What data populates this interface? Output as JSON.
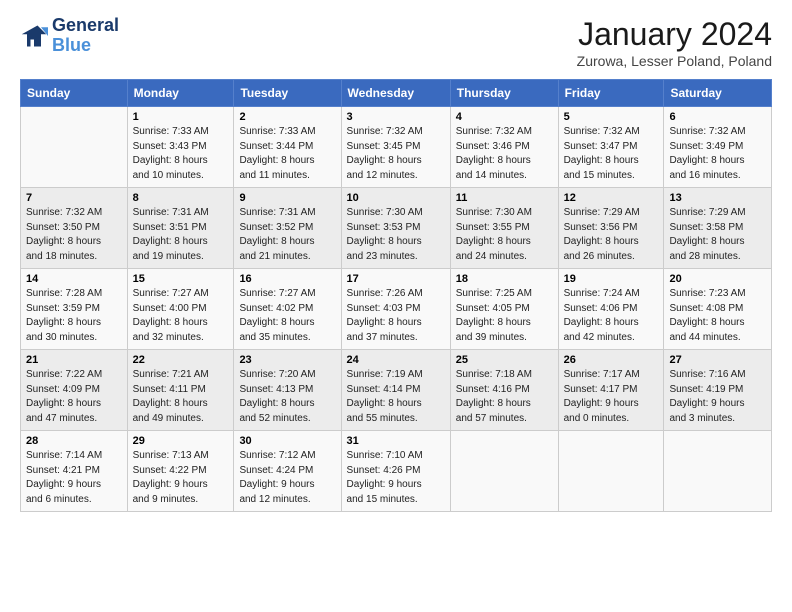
{
  "logo": {
    "line1": "General",
    "line2": "Blue"
  },
  "title": "January 2024",
  "location": "Zurowa, Lesser Poland, Poland",
  "days_of_week": [
    "Sunday",
    "Monday",
    "Tuesday",
    "Wednesday",
    "Thursday",
    "Friday",
    "Saturday"
  ],
  "weeks": [
    [
      {
        "num": "",
        "info": ""
      },
      {
        "num": "1",
        "info": "Sunrise: 7:33 AM\nSunset: 3:43 PM\nDaylight: 8 hours\nand 10 minutes."
      },
      {
        "num": "2",
        "info": "Sunrise: 7:33 AM\nSunset: 3:44 PM\nDaylight: 8 hours\nand 11 minutes."
      },
      {
        "num": "3",
        "info": "Sunrise: 7:32 AM\nSunset: 3:45 PM\nDaylight: 8 hours\nand 12 minutes."
      },
      {
        "num": "4",
        "info": "Sunrise: 7:32 AM\nSunset: 3:46 PM\nDaylight: 8 hours\nand 14 minutes."
      },
      {
        "num": "5",
        "info": "Sunrise: 7:32 AM\nSunset: 3:47 PM\nDaylight: 8 hours\nand 15 minutes."
      },
      {
        "num": "6",
        "info": "Sunrise: 7:32 AM\nSunset: 3:49 PM\nDaylight: 8 hours\nand 16 minutes."
      }
    ],
    [
      {
        "num": "7",
        "info": "Sunrise: 7:32 AM\nSunset: 3:50 PM\nDaylight: 8 hours\nand 18 minutes."
      },
      {
        "num": "8",
        "info": "Sunrise: 7:31 AM\nSunset: 3:51 PM\nDaylight: 8 hours\nand 19 minutes."
      },
      {
        "num": "9",
        "info": "Sunrise: 7:31 AM\nSunset: 3:52 PM\nDaylight: 8 hours\nand 21 minutes."
      },
      {
        "num": "10",
        "info": "Sunrise: 7:30 AM\nSunset: 3:53 PM\nDaylight: 8 hours\nand 23 minutes."
      },
      {
        "num": "11",
        "info": "Sunrise: 7:30 AM\nSunset: 3:55 PM\nDaylight: 8 hours\nand 24 minutes."
      },
      {
        "num": "12",
        "info": "Sunrise: 7:29 AM\nSunset: 3:56 PM\nDaylight: 8 hours\nand 26 minutes."
      },
      {
        "num": "13",
        "info": "Sunrise: 7:29 AM\nSunset: 3:58 PM\nDaylight: 8 hours\nand 28 minutes."
      }
    ],
    [
      {
        "num": "14",
        "info": "Sunrise: 7:28 AM\nSunset: 3:59 PM\nDaylight: 8 hours\nand 30 minutes."
      },
      {
        "num": "15",
        "info": "Sunrise: 7:27 AM\nSunset: 4:00 PM\nDaylight: 8 hours\nand 32 minutes."
      },
      {
        "num": "16",
        "info": "Sunrise: 7:27 AM\nSunset: 4:02 PM\nDaylight: 8 hours\nand 35 minutes."
      },
      {
        "num": "17",
        "info": "Sunrise: 7:26 AM\nSunset: 4:03 PM\nDaylight: 8 hours\nand 37 minutes."
      },
      {
        "num": "18",
        "info": "Sunrise: 7:25 AM\nSunset: 4:05 PM\nDaylight: 8 hours\nand 39 minutes."
      },
      {
        "num": "19",
        "info": "Sunrise: 7:24 AM\nSunset: 4:06 PM\nDaylight: 8 hours\nand 42 minutes."
      },
      {
        "num": "20",
        "info": "Sunrise: 7:23 AM\nSunset: 4:08 PM\nDaylight: 8 hours\nand 44 minutes."
      }
    ],
    [
      {
        "num": "21",
        "info": "Sunrise: 7:22 AM\nSunset: 4:09 PM\nDaylight: 8 hours\nand 47 minutes."
      },
      {
        "num": "22",
        "info": "Sunrise: 7:21 AM\nSunset: 4:11 PM\nDaylight: 8 hours\nand 49 minutes."
      },
      {
        "num": "23",
        "info": "Sunrise: 7:20 AM\nSunset: 4:13 PM\nDaylight: 8 hours\nand 52 minutes."
      },
      {
        "num": "24",
        "info": "Sunrise: 7:19 AM\nSunset: 4:14 PM\nDaylight: 8 hours\nand 55 minutes."
      },
      {
        "num": "25",
        "info": "Sunrise: 7:18 AM\nSunset: 4:16 PM\nDaylight: 8 hours\nand 57 minutes."
      },
      {
        "num": "26",
        "info": "Sunrise: 7:17 AM\nSunset: 4:17 PM\nDaylight: 9 hours\nand 0 minutes."
      },
      {
        "num": "27",
        "info": "Sunrise: 7:16 AM\nSunset: 4:19 PM\nDaylight: 9 hours\nand 3 minutes."
      }
    ],
    [
      {
        "num": "28",
        "info": "Sunrise: 7:14 AM\nSunset: 4:21 PM\nDaylight: 9 hours\nand 6 minutes."
      },
      {
        "num": "29",
        "info": "Sunrise: 7:13 AM\nSunset: 4:22 PM\nDaylight: 9 hours\nand 9 minutes."
      },
      {
        "num": "30",
        "info": "Sunrise: 7:12 AM\nSunset: 4:24 PM\nDaylight: 9 hours\nand 12 minutes."
      },
      {
        "num": "31",
        "info": "Sunrise: 7:10 AM\nSunset: 4:26 PM\nDaylight: 9 hours\nand 15 minutes."
      },
      {
        "num": "",
        "info": ""
      },
      {
        "num": "",
        "info": ""
      },
      {
        "num": "",
        "info": ""
      }
    ]
  ]
}
